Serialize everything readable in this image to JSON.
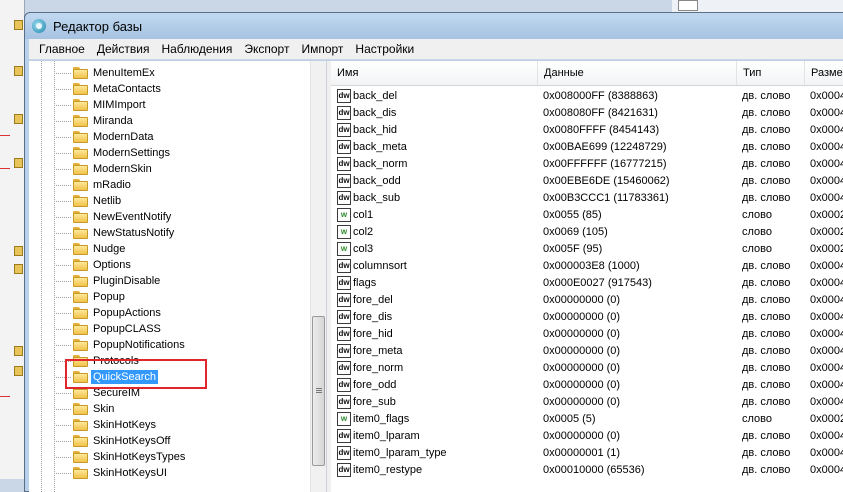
{
  "window": {
    "title": "Редактор базы"
  },
  "menu": [
    "Главное",
    "Действия",
    "Наблюдения",
    "Экспорт",
    "Импорт",
    "Настройки"
  ],
  "tree": {
    "items": [
      "MenuItemEx",
      "MetaContacts",
      "MIMImport",
      "Miranda",
      "ModernData",
      "ModernSettings",
      "ModernSkin",
      "mRadio",
      "Netlib",
      "NewEventNotify",
      "NewStatusNotify",
      "Nudge",
      "Options",
      "PluginDisable",
      "Popup",
      "PopupActions",
      "PopupCLASS",
      "PopupNotifications",
      "Protocols",
      "QuickSearch",
      "SecureIM",
      "Skin",
      "SkinHotKeys",
      "SkinHotKeysOff",
      "SkinHotKeysTypes",
      "SkinHotKeysUI"
    ],
    "selected_index": 19
  },
  "list": {
    "columns": [
      "Имя",
      "Данные",
      "Тип",
      "Размер"
    ],
    "rows": [
      {
        "icon": "dw",
        "name": "back_del",
        "data": "0x008000FF (8388863)",
        "type": "дв. слово",
        "size": "0x0004"
      },
      {
        "icon": "dw",
        "name": "back_dis",
        "data": "0x008080FF (8421631)",
        "type": "дв. слово",
        "size": "0x0004"
      },
      {
        "icon": "dw",
        "name": "back_hid",
        "data": "0x0080FFFF (8454143)",
        "type": "дв. слово",
        "size": "0x0004"
      },
      {
        "icon": "dw",
        "name": "back_meta",
        "data": "0x00BAE699 (12248729)",
        "type": "дв. слово",
        "size": "0x0004"
      },
      {
        "icon": "dw",
        "name": "back_norm",
        "data": "0x00FFFFFF (16777215)",
        "type": "дв. слово",
        "size": "0x0004"
      },
      {
        "icon": "dw",
        "name": "back_odd",
        "data": "0x00EBE6DE (15460062)",
        "type": "дв. слово",
        "size": "0x0004"
      },
      {
        "icon": "dw",
        "name": "back_sub",
        "data": "0x00B3CCC1 (11783361)",
        "type": "дв. слово",
        "size": "0x0004"
      },
      {
        "icon": "w",
        "name": "col1",
        "data": "0x0055 (85)",
        "type": "слово",
        "size": "0x0002"
      },
      {
        "icon": "w",
        "name": "col2",
        "data": "0x0069 (105)",
        "type": "слово",
        "size": "0x0002"
      },
      {
        "icon": "w",
        "name": "col3",
        "data": "0x005F (95)",
        "type": "слово",
        "size": "0x0002"
      },
      {
        "icon": "dw",
        "name": "columnsort",
        "data": "0x000003E8 (1000)",
        "type": "дв. слово",
        "size": "0x0004"
      },
      {
        "icon": "dw",
        "name": "flags",
        "data": "0x000E0027 (917543)",
        "type": "дв. слово",
        "size": "0x0004"
      },
      {
        "icon": "dw",
        "name": "fore_del",
        "data": "0x00000000 (0)",
        "type": "дв. слово",
        "size": "0x0004"
      },
      {
        "icon": "dw",
        "name": "fore_dis",
        "data": "0x00000000 (0)",
        "type": "дв. слово",
        "size": "0x0004"
      },
      {
        "icon": "dw",
        "name": "fore_hid",
        "data": "0x00000000 (0)",
        "type": "дв. слово",
        "size": "0x0004"
      },
      {
        "icon": "dw",
        "name": "fore_meta",
        "data": "0x00000000 (0)",
        "type": "дв. слово",
        "size": "0x0004"
      },
      {
        "icon": "dw",
        "name": "fore_norm",
        "data": "0x00000000 (0)",
        "type": "дв. слово",
        "size": "0x0004"
      },
      {
        "icon": "dw",
        "name": "fore_odd",
        "data": "0x00000000 (0)",
        "type": "дв. слово",
        "size": "0x0004"
      },
      {
        "icon": "dw",
        "name": "fore_sub",
        "data": "0x00000000 (0)",
        "type": "дв. слово",
        "size": "0x0004"
      },
      {
        "icon": "w",
        "name": "item0_flags",
        "data": "0x0005 (5)",
        "type": "слово",
        "size": "0x0002"
      },
      {
        "icon": "dw",
        "name": "item0_lparam",
        "data": "0x00000000 (0)",
        "type": "дв. слово",
        "size": "0x0004"
      },
      {
        "icon": "dw",
        "name": "item0_lparam_type",
        "data": "0x00000001 (1)",
        "type": "дв. слово",
        "size": "0x0004"
      },
      {
        "icon": "dw",
        "name": "item0_restype",
        "data": "0x00010000 (65536)",
        "type": "дв. слово",
        "size": "0x0004"
      }
    ]
  },
  "icons": {
    "dword": "dw",
    "word": "w"
  },
  "colors": {
    "selection": "#3399ff",
    "highlight_box": "#e0252b",
    "folder": "#f0c24c"
  }
}
